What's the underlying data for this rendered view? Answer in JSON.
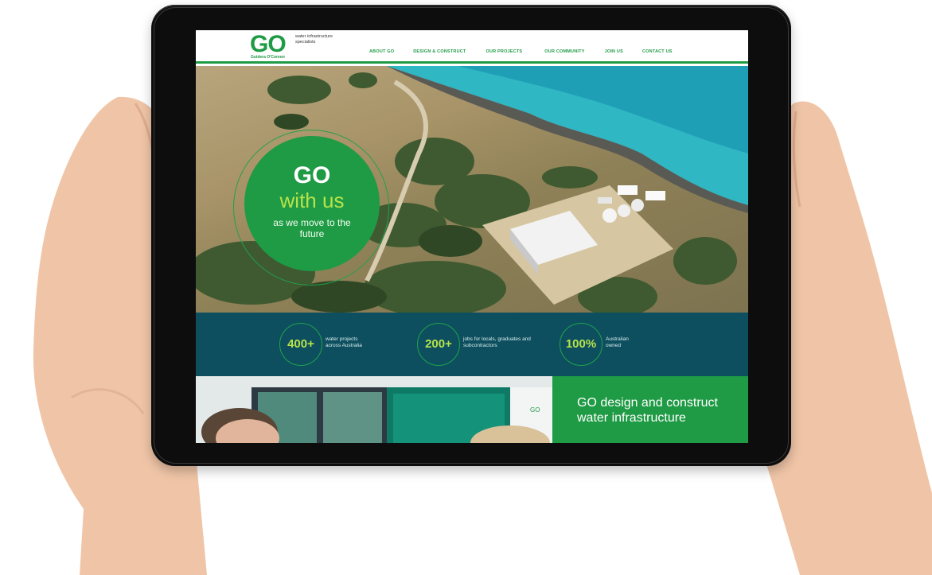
{
  "brand": {
    "logo": "GO",
    "company": "Guidera O'Connor",
    "tagline": "water infrastructure specialists",
    "accent_color": "#1f9a45",
    "lime_color": "#b7e34a",
    "teal_color": "#0d4f5e"
  },
  "nav": {
    "items": [
      {
        "label": "ABOUT GO"
      },
      {
        "label": "DESIGN & CONSTRUCT"
      },
      {
        "label": "OUR PROJECTS"
      },
      {
        "label": "OUR COMMUNITY"
      },
      {
        "label": "JOIN US"
      },
      {
        "label": "CONTACT US"
      }
    ]
  },
  "hero": {
    "line1": "GO",
    "line2": "with us",
    "line3": "as we move to the future"
  },
  "stats": [
    {
      "value": "400+",
      "label": "water projects across Australia"
    },
    {
      "value": "200+",
      "label": "jobs for locals, graduates and subcontractors"
    },
    {
      "value": "100%",
      "label": "Australian owned"
    }
  ],
  "promo": {
    "heading": "GO design and construct water infrastructure"
  },
  "photo_screen_logo": "GO"
}
